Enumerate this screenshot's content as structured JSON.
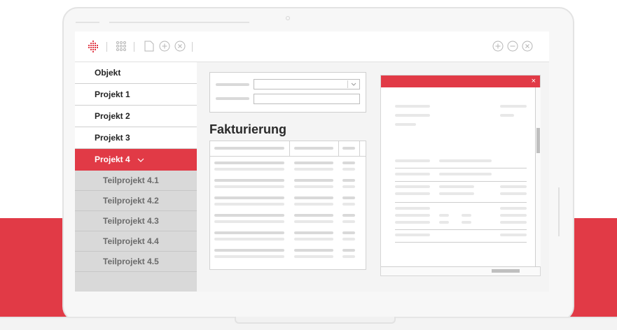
{
  "sidebar": {
    "items": [
      {
        "label": "Objekt"
      },
      {
        "label": "Projekt 1"
      },
      {
        "label": "Projekt 2"
      },
      {
        "label": "Projekt 3"
      },
      {
        "label": "Projekt 4",
        "active": true
      }
    ],
    "subitems": [
      {
        "label": "Teilprojekt 4.1"
      },
      {
        "label": "Teilprojekt 4.2"
      },
      {
        "label": "Teilprojekt 4.3"
      },
      {
        "label": "Teilprojekt 4.4"
      },
      {
        "label": "Teilprojekt 4.5"
      }
    ]
  },
  "main": {
    "heading": "Fakturierung"
  },
  "panel": {
    "close_symbol": "×"
  },
  "colors": {
    "accent": "#e13a46",
    "sidebar_sub_bg": "#d9d9d9",
    "content_bg": "#f4f4f4"
  },
  "icons": [
    "logo-icon",
    "grid-icon",
    "document-icon",
    "add-icon",
    "close-icon",
    "window-add-icon",
    "window-minimize-icon",
    "window-close-icon",
    "chevron-down-icon"
  ]
}
